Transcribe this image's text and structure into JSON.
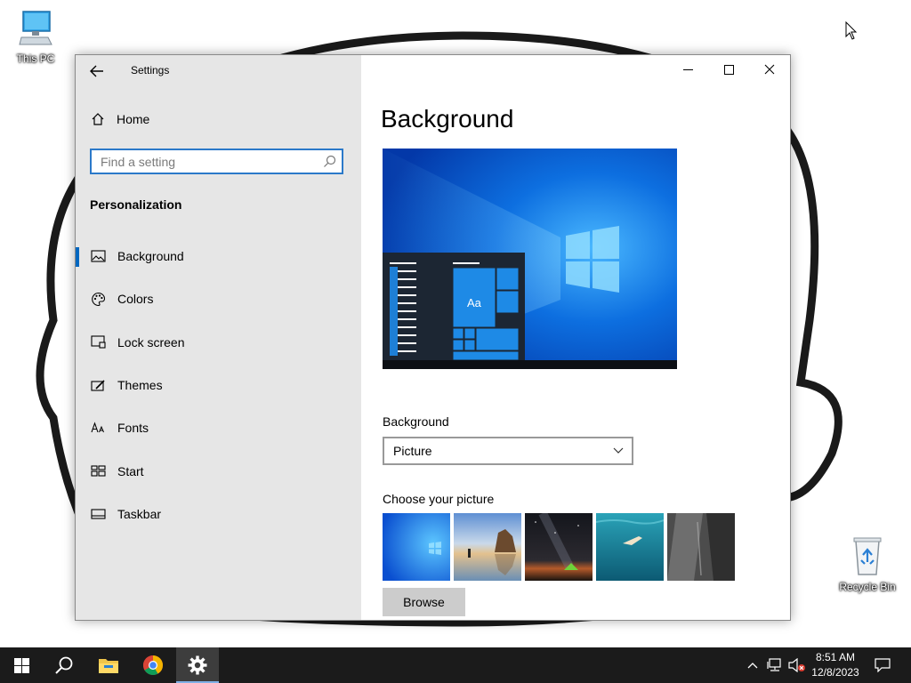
{
  "desktop": {
    "icons": [
      {
        "label": "This PC"
      },
      {
        "label": "Recycle Bin"
      }
    ]
  },
  "window": {
    "title": "Settings",
    "controls": {
      "minimize": "minimize",
      "maximize": "maximize",
      "close": "close"
    }
  },
  "sidebar": {
    "home_label": "Home",
    "search_placeholder": "Find a setting",
    "section_title": "Personalization",
    "items": [
      {
        "label": "Background",
        "icon": "picture-icon",
        "active": true
      },
      {
        "label": "Colors",
        "icon": "palette-icon",
        "active": false
      },
      {
        "label": "Lock screen",
        "icon": "lock-screen-icon",
        "active": false
      },
      {
        "label": "Themes",
        "icon": "themes-icon",
        "active": false
      },
      {
        "label": "Fonts",
        "icon": "fonts-icon",
        "active": false
      },
      {
        "label": "Start",
        "icon": "start-icon",
        "active": false
      },
      {
        "label": "Taskbar",
        "icon": "taskbar-icon",
        "active": false
      }
    ]
  },
  "main": {
    "title": "Background",
    "preview_tile_text": "Aa",
    "background_label": "Background",
    "background_value": "Picture",
    "choose_label": "Choose your picture",
    "thumbnails": [
      "windows-blue",
      "beach-rocks",
      "night-sky-tent",
      "underwater-swimmer",
      "rock-cliff"
    ],
    "browse_label": "Browse"
  },
  "taskbar": {
    "time": "8:51 AM",
    "date": "12/8/2023",
    "accent": "#7fb0e6"
  },
  "colors": {
    "accent": "#0067c0",
    "search_border": "#2b79c9",
    "sidebar_bg": "#e6e6e6",
    "taskbar_bg": "#1b1b1b"
  }
}
